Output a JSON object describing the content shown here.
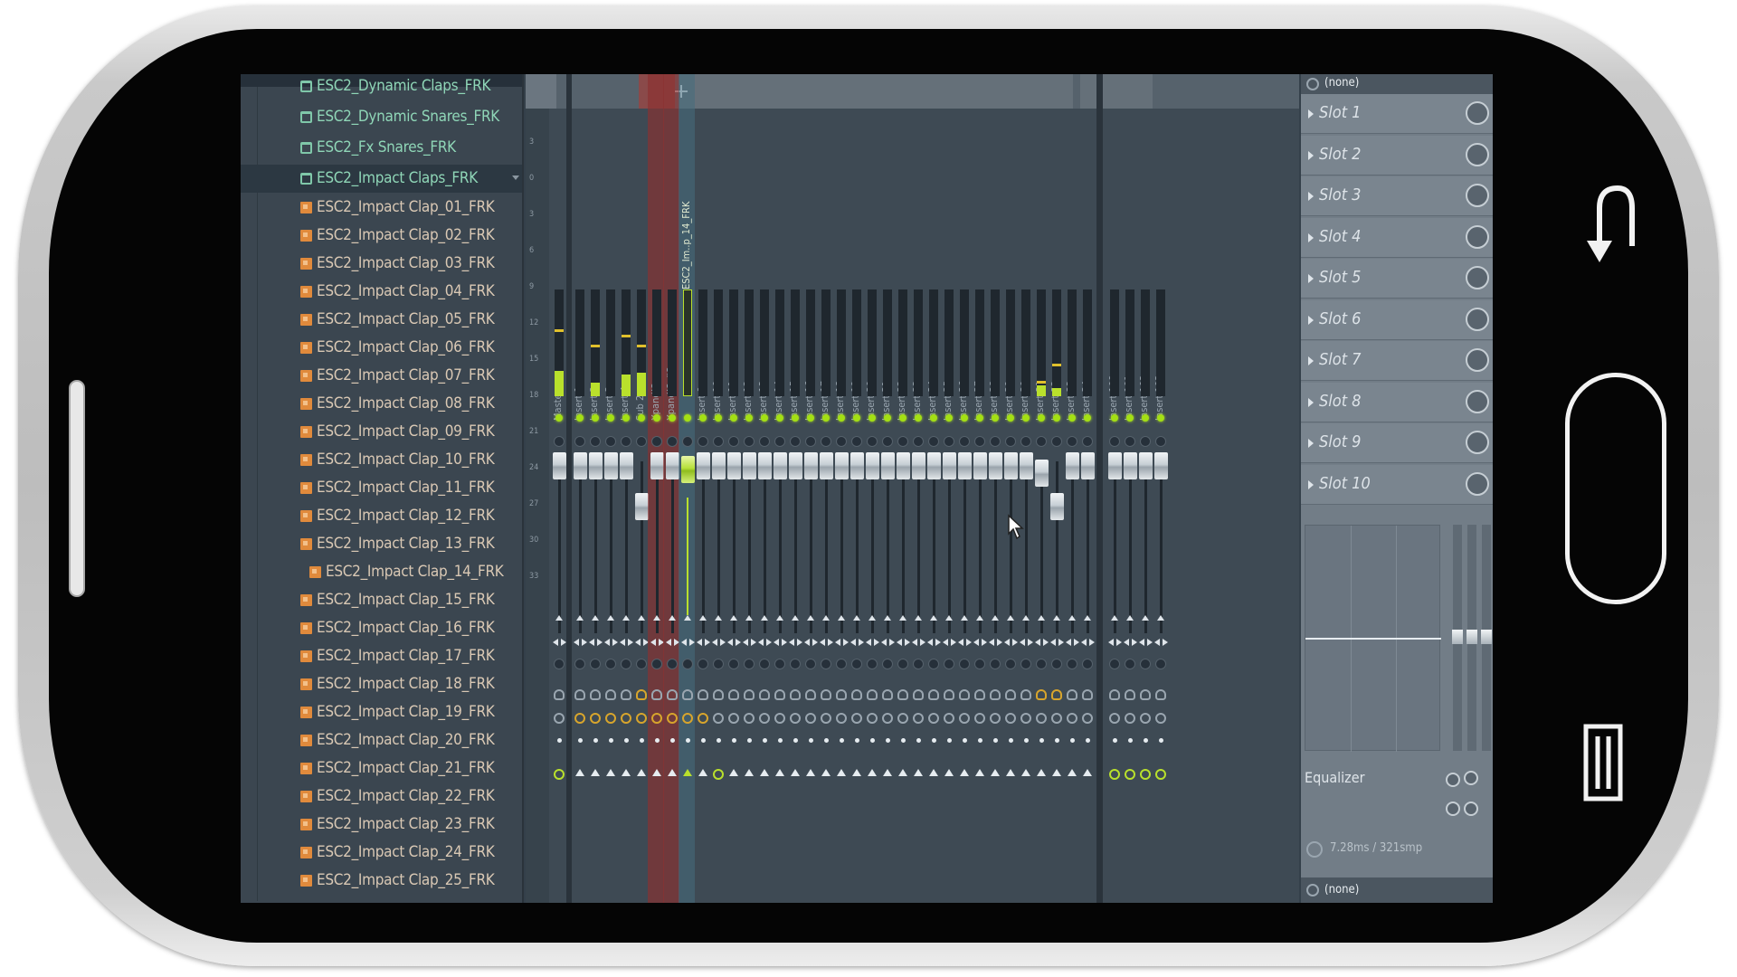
{
  "browser": {
    "items": [
      {
        "label": "ESC2_Dynamic Claps_FRK",
        "type": "folder"
      },
      {
        "label": "ESC2_Dynamic Snares_FRK",
        "type": "folder"
      },
      {
        "label": "ESC2_Fx Snares_FRK",
        "type": "folder"
      },
      {
        "label": "ESC2_Impact Claps_FRK",
        "type": "folder",
        "selected": true
      },
      {
        "label": "ESC2_Impact Clap_01_FRK",
        "type": "file"
      },
      {
        "label": "ESC2_Impact Clap_02_FRK",
        "type": "file"
      },
      {
        "label": "ESC2_Impact Clap_03_FRK",
        "type": "file"
      },
      {
        "label": "ESC2_Impact Clap_04_FRK",
        "type": "file"
      },
      {
        "label": "ESC2_Impact Clap_05_FRK",
        "type": "file"
      },
      {
        "label": "ESC2_Impact Clap_06_FRK",
        "type": "file"
      },
      {
        "label": "ESC2_Impact Clap_07_FRK",
        "type": "file"
      },
      {
        "label": "ESC2_Impact Clap_08_FRK",
        "type": "file"
      },
      {
        "label": "ESC2_Impact Clap_09_FRK",
        "type": "file"
      },
      {
        "label": "ESC2_Impact Clap_10_FRK",
        "type": "file"
      },
      {
        "label": "ESC2_Impact Clap_11_FRK",
        "type": "file"
      },
      {
        "label": "ESC2_Impact Clap_12_FRK",
        "type": "file"
      },
      {
        "label": "ESC2_Impact Clap_13_FRK",
        "type": "file"
      },
      {
        "label": "ESC2_Impact Clap_14_FRK",
        "type": "file",
        "playing": true
      },
      {
        "label": "ESC2_Impact Clap_15_FRK",
        "type": "file"
      },
      {
        "label": "ESC2_Impact Clap_16_FRK",
        "type": "file"
      },
      {
        "label": "ESC2_Impact Clap_17_FRK",
        "type": "file"
      },
      {
        "label": "ESC2_Impact Clap_18_FRK",
        "type": "file"
      },
      {
        "label": "ESC2_Impact Clap_19_FRK",
        "type": "file"
      },
      {
        "label": "ESC2_Impact Clap_20_FRK",
        "type": "file"
      },
      {
        "label": "ESC2_Impact Clap_21_FRK",
        "type": "file"
      },
      {
        "label": "ESC2_Impact Clap_22_FRK",
        "type": "file"
      },
      {
        "label": "ESC2_Impact Clap_23_FRK",
        "type": "file"
      },
      {
        "label": "ESC2_Impact Clap_24_FRK",
        "type": "file"
      },
      {
        "label": "ESC2_Impact Clap_25_FRK",
        "type": "file"
      }
    ]
  },
  "mixer": {
    "scale": [
      "3",
      "0",
      "3",
      "6",
      "9",
      "12",
      "15",
      "18",
      "21",
      "24",
      "27",
      "30",
      "33"
    ],
    "tracks_group1": [
      {
        "label": "Master",
        "level": 0.24,
        "peak": 0.6
      },
      {
        "label": "Insert 1",
        "level": 0,
        "peak": 0
      },
      {
        "label": "Insert 2",
        "level": 0.13,
        "peak": 0.46
      },
      {
        "label": "Insert 3",
        "level": 0,
        "peak": 0
      },
      {
        "label": "Insert 4",
        "level": 0.2,
        "peak": 0.55
      },
      {
        "label": "Sub 2",
        "level": 0.22,
        "peak": 0.46,
        "fader_low": true
      },
      {
        "label": "Xpand!2",
        "level": 0,
        "peak": 0,
        "highlight": "red"
      },
      {
        "label": "Xpand!2 #3",
        "level": 0,
        "peak": 0,
        "highlight": "red"
      },
      {
        "label": "ESC2_Im..p_14_FRK",
        "level": 0,
        "peak": 0,
        "highlight": "teal",
        "active": true
      },
      {
        "label": "Insert 9"
      },
      {
        "label": "Insert 10"
      },
      {
        "label": "Insert 11"
      },
      {
        "label": "Insert 12"
      },
      {
        "label": "Insert 13"
      },
      {
        "label": "Insert 14"
      },
      {
        "label": "Insert 15"
      },
      {
        "label": "Insert 16"
      },
      {
        "label": "Insert 17"
      },
      {
        "label": "Insert 18"
      },
      {
        "label": "Insert 19"
      },
      {
        "label": "Insert 20"
      },
      {
        "label": "Insert 21"
      },
      {
        "label": "Insert 22"
      },
      {
        "label": "Insert 23"
      },
      {
        "label": "Insert 24"
      },
      {
        "label": "Insert 25"
      },
      {
        "label": "Insert 26"
      },
      {
        "label": "Insert 27"
      },
      {
        "label": "Insert 28"
      },
      {
        "label": "Insert 29"
      },
      {
        "label": "Insert 30"
      },
      {
        "label": "Insert 31",
        "level": 0.1,
        "peak": 0.12,
        "fader_mid": true
      },
      {
        "label": "Insert 32",
        "level": 0.08,
        "peak": 0.28,
        "fader_low": true
      },
      {
        "label": "Insert 33"
      },
      {
        "label": "Insert 34"
      }
    ],
    "tracks_group2": [
      {
        "label": "Insert 100"
      },
      {
        "label": "Insert 101"
      },
      {
        "label": "Insert 102"
      },
      {
        "label": "Insert 103"
      }
    ]
  },
  "fx": {
    "top_selector": "(none)",
    "slots": [
      "Slot 1",
      "Slot 2",
      "Slot 3",
      "Slot 4",
      "Slot 5",
      "Slot 6",
      "Slot 7",
      "Slot 8",
      "Slot 9",
      "Slot 10"
    ],
    "equalizer_label": "Equalizer",
    "latency": "7.28ms / 321smp",
    "bottom_selector": "(none)"
  },
  "colors": {
    "meter_green": "#b9e02c",
    "highlight_red": "#8c3030",
    "folder_text": "#8fd6b7",
    "file_text": "#d9c8b4"
  },
  "icons": {
    "back": "back-arrow-icon",
    "home": "home-button",
    "menu": "recent-apps-icon",
    "add": "add-icon",
    "cursor": "mouse-cursor-icon"
  }
}
